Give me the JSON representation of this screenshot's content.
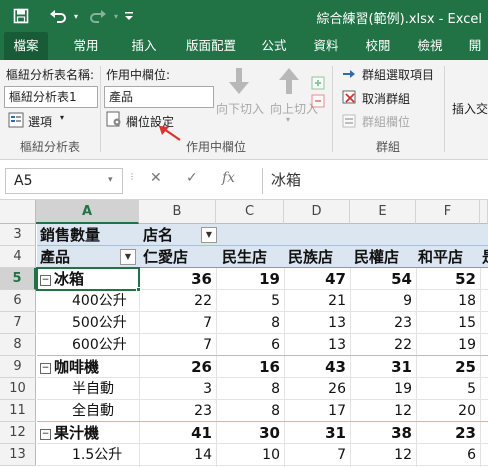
{
  "window": {
    "title": "綜合練習(範例).xlsx - Excel"
  },
  "quick_access": {
    "save_icon": "save-icon",
    "undo_icon": "undo-icon",
    "redo_icon": "redo-icon",
    "customize_icon": "customize-qat-icon"
  },
  "tabs": [
    {
      "label": "檔案"
    },
    {
      "label": "常用"
    },
    {
      "label": "插入"
    },
    {
      "label": "版面配置"
    },
    {
      "label": "公式"
    },
    {
      "label": "資料"
    },
    {
      "label": "校閱"
    },
    {
      "label": "檢視"
    },
    {
      "label": "開"
    }
  ],
  "ribbon": {
    "pivot_name_label": "樞紐分析表名稱:",
    "pivot_name_value": "樞紐分析表1",
    "options_label": "選項",
    "group_pivot": "樞紐分析表",
    "active_field_label": "作用中欄位:",
    "active_field_value": "產品",
    "field_settings_label": "欄位設定",
    "drill_down_label": "向下切入",
    "drill_up_label": "向上切入",
    "group_active_field": "作用中欄位",
    "group_selection_label": "群組選取項目",
    "ungroup_label": "取消群組",
    "group_field_label": "群組欄位",
    "group_group": "群組",
    "insert_label": "插入交"
  },
  "formula_bar": {
    "name_box": "A5",
    "content": "冰箱",
    "fx": "fx"
  },
  "grid": {
    "columns": [
      "A",
      "B",
      "C",
      "D",
      "E",
      "F"
    ],
    "rows": [
      "3",
      "4",
      "5",
      "6",
      "7",
      "8",
      "9",
      "10",
      "11",
      "12",
      "13"
    ],
    "row3": {
      "a": "銷售數量",
      "b": "店名"
    },
    "row4": {
      "a": "產品",
      "b": "仁愛店",
      "c": "民生店",
      "d": "民族店",
      "e": "民權店",
      "f": "和平店",
      "g": "是"
    },
    "data": [
      {
        "label": "冰箱",
        "level": 0,
        "values": [
          "36",
          "19",
          "47",
          "54",
          "52"
        ]
      },
      {
        "label": "400公升",
        "level": 1,
        "values": [
          "22",
          "5",
          "21",
          "9",
          "18"
        ]
      },
      {
        "label": "500公升",
        "level": 1,
        "values": [
          "7",
          "8",
          "13",
          "23",
          "15"
        ]
      },
      {
        "label": "600公升",
        "level": 1,
        "values": [
          "7",
          "6",
          "13",
          "22",
          "19"
        ]
      },
      {
        "label": "咖啡機",
        "level": 0,
        "values": [
          "26",
          "16",
          "43",
          "31",
          "25"
        ]
      },
      {
        "label": "半自動",
        "level": 1,
        "values": [
          "3",
          "8",
          "26",
          "19",
          "5"
        ]
      },
      {
        "label": "全自動",
        "level": 1,
        "values": [
          "23",
          "8",
          "17",
          "12",
          "20"
        ]
      },
      {
        "label": "果汁機",
        "level": 0,
        "values": [
          "41",
          "30",
          "31",
          "38",
          "23"
        ]
      },
      {
        "label": "1.5公升",
        "level": 1,
        "values": [
          "14",
          "10",
          "7",
          "12",
          "6"
        ]
      }
    ]
  },
  "colors": {
    "accent": "#217346",
    "pivot_header": "#dce6f1",
    "arrow": "#e0312a"
  }
}
